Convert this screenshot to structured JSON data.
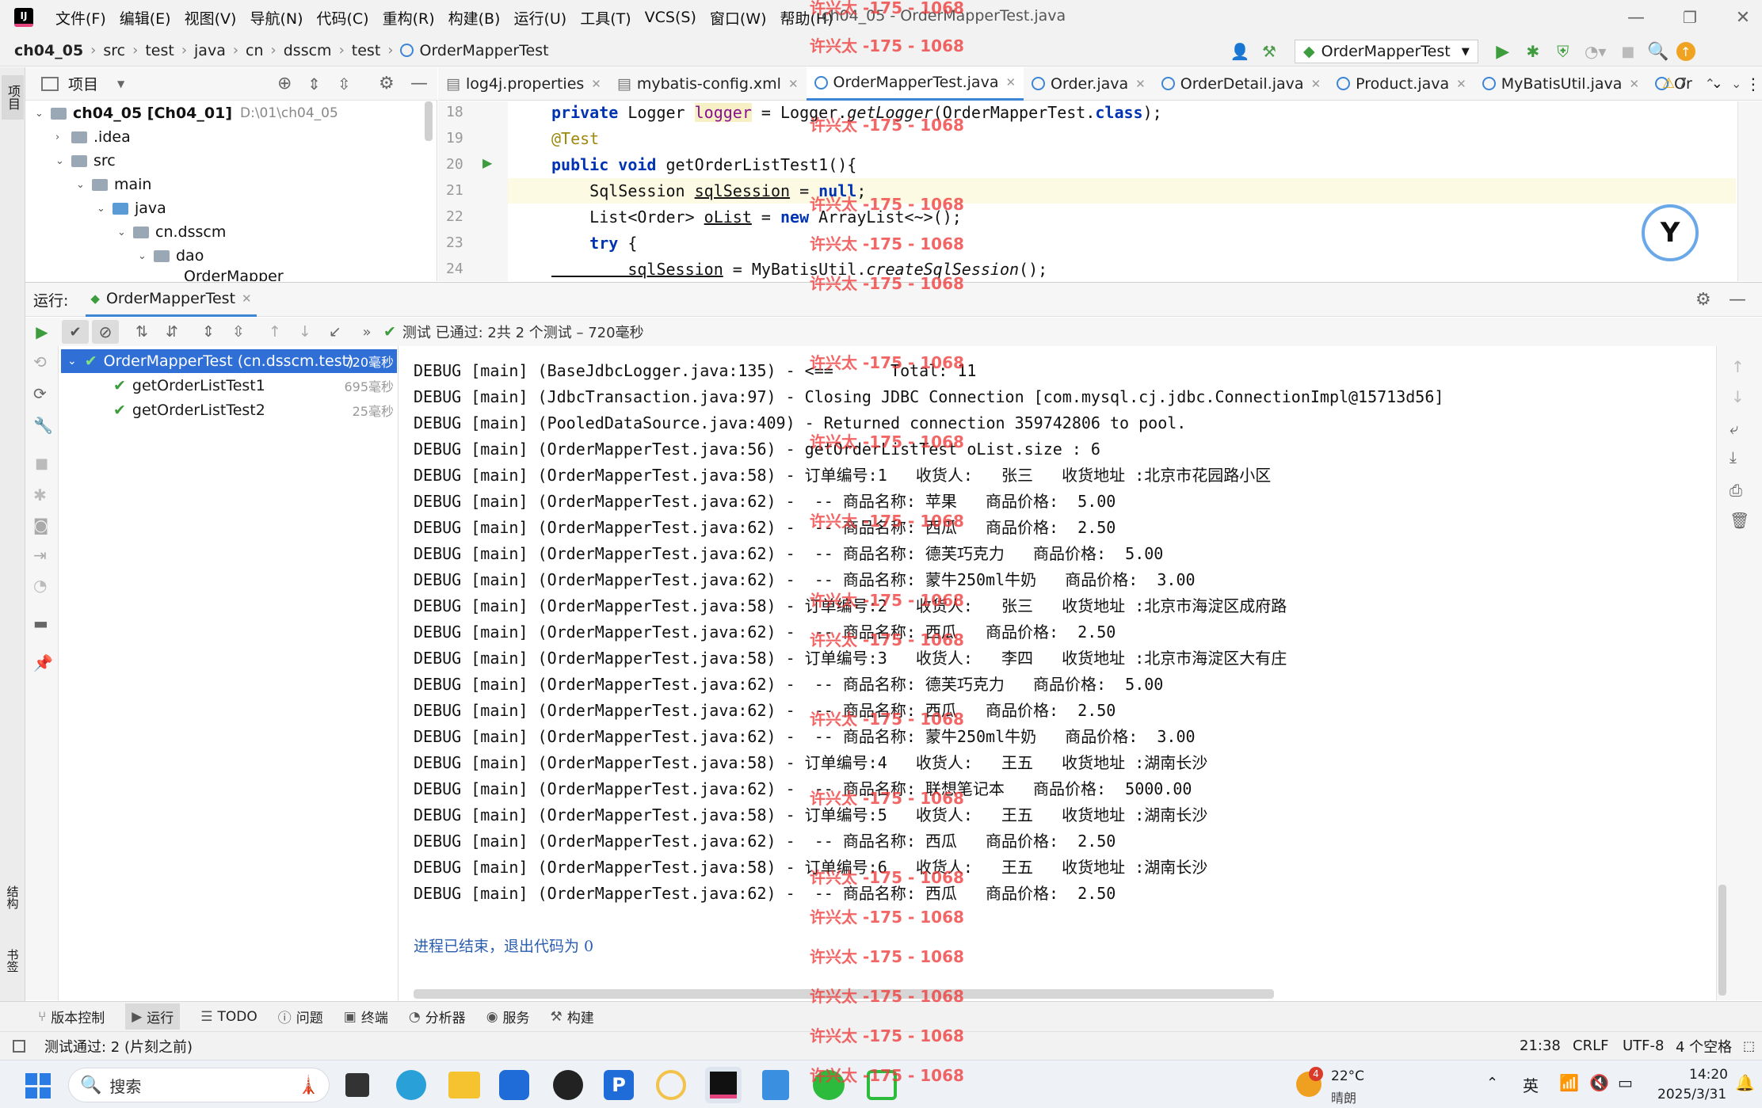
{
  "titlebar": {
    "menus": [
      "文件(F)",
      "编辑(E)",
      "视图(V)",
      "导航(N)",
      "代码(C)",
      "重构(R)",
      "构建(B)",
      "运行(U)",
      "工具(T)",
      "VCS(S)",
      "窗口(W)",
      "帮助(H)"
    ],
    "title": "ch04_05 - OrderMapperTest.java"
  },
  "nav": {
    "crumbs": [
      "ch04_05",
      "src",
      "test",
      "java",
      "cn",
      "dsscm",
      "test",
      "OrderMapperTest"
    ],
    "run_config": "OrderMapperTest"
  },
  "project": {
    "header": "项目",
    "items": [
      {
        "label": "ch04_05 [Ch04_01]",
        "hint": "D:\\01\\ch04_05"
      },
      {
        "label": ".idea"
      },
      {
        "label": "src"
      },
      {
        "label": "main"
      },
      {
        "label": "java"
      },
      {
        "label": "cn.dsscm"
      },
      {
        "label": "dao"
      },
      {
        "label": "OrderMapper"
      }
    ]
  },
  "editor": {
    "tabs": [
      "log4j.properties",
      "mybatis-config.xml",
      "OrderMapperTest.java",
      "Order.java",
      "OrderDetail.java",
      "Product.java",
      "MyBatisUtil.java",
      "Or"
    ],
    "warnings": "7",
    "line_numbers": [
      "18",
      "19",
      "20",
      "21",
      "22",
      "23",
      "24"
    ],
    "lines": [
      [
        {
          "t": "private ",
          "c": "kw"
        },
        {
          "t": "Logger "
        },
        {
          "t": "logger",
          "c": "fld"
        },
        {
          "t": " = Logger."
        },
        {
          "t": "getLogger",
          "c": "ital"
        },
        {
          "t": "(OrderMapperTest."
        },
        {
          "t": "class",
          "c": "kw"
        },
        {
          "t": ");"
        }
      ],
      [
        {
          "t": "@Test",
          "c": "ann"
        }
      ],
      [
        {
          "t": "public void ",
          "c": "kw"
        },
        {
          "t": "getOrderListTest1(){"
        }
      ],
      [
        {
          "t": "    SqlSession "
        },
        {
          "t": "sqlSession",
          "c": "u"
        },
        {
          "t": " = "
        },
        {
          "t": "null",
          "c": "kw"
        },
        {
          "t": ";"
        }
      ],
      [
        {
          "t": "    List<Order> "
        },
        {
          "t": "oList",
          "c": "u"
        },
        {
          "t": " = "
        },
        {
          "t": "new ",
          "c": "kw"
        },
        {
          "t": "ArrayList<~>();"
        }
      ],
      [
        {
          "t": "    "
        },
        {
          "t": "try ",
          "c": "kw"
        },
        {
          "t": "{"
        }
      ],
      [
        {
          "t": "        sqlSession",
          "c": "u"
        },
        {
          "t": " = MyBatisUtil."
        },
        {
          "t": "createSqlSession",
          "c": "ital"
        },
        {
          "t": "();"
        }
      ]
    ]
  },
  "run": {
    "label": "运行:",
    "tab": "OrderMapperTest",
    "status": "测试 已通过: 2共 2 个测试 – 720毫秒",
    "tests": [
      {
        "name": "OrderMapperTest (cn.dsscm.test)",
        "time": "720毫秒"
      },
      {
        "name": "getOrderListTest1",
        "time": "695毫秒"
      },
      {
        "name": "getOrderListTest2",
        "time": "25毫秒"
      }
    ]
  },
  "console": {
    "lines": [
      "DEBUG [main] (BaseJdbcLogger.java:135) - <==      Total: 11",
      "DEBUG [main] (JdbcTransaction.java:97) - Closing JDBC Connection [com.mysql.cj.jdbc.ConnectionImpl@15713d56]",
      "DEBUG [main] (PooledDataSource.java:409) - Returned connection 359742806 to pool.",
      "DEBUG [main] (OrderMapperTest.java:56) - getOrderListTest oList.size : 6",
      "DEBUG [main] (OrderMapperTest.java:58) - 订单编号:1   收货人:   张三   收货地址 :北京市花园路小区",
      "DEBUG [main] (OrderMapperTest.java:62) -  -- 商品名称: 苹果   商品价格:  5.00",
      "DEBUG [main] (OrderMapperTest.java:62) -  -- 商品名称: 西瓜   商品价格:  2.50",
      "DEBUG [main] (OrderMapperTest.java:62) -  -- 商品名称: 德芙巧克力   商品价格:  5.00",
      "DEBUG [main] (OrderMapperTest.java:62) -  -- 商品名称: 蒙牛250ml牛奶   商品价格:  3.00",
      "DEBUG [main] (OrderMapperTest.java:58) - 订单编号:2   收货人:   张三   收货地址 :北京市海淀区成府路",
      "DEBUG [main] (OrderMapperTest.java:62) -  -- 商品名称: 西瓜   商品价格:  2.50",
      "DEBUG [main] (OrderMapperTest.java:58) - 订单编号:3   收货人:   李四   收货地址 :北京市海淀区大有庄",
      "DEBUG [main] (OrderMapperTest.java:62) -  -- 商品名称: 德芙巧克力   商品价格:  5.00",
      "DEBUG [main] (OrderMapperTest.java:62) -  -- 商品名称: 西瓜   商品价格:  2.50",
      "DEBUG [main] (OrderMapperTest.java:62) -  -- 商品名称: 蒙牛250ml牛奶   商品价格:  3.00",
      "DEBUG [main] (OrderMapperTest.java:58) - 订单编号:4   收货人:   王五   收货地址 :湖南长沙",
      "DEBUG [main] (OrderMapperTest.java:62) -  -- 商品名称: 联想笔记本   商品价格:  5000.00",
      "DEBUG [main] (OrderMapperTest.java:58) - 订单编号:5   收货人:   王五   收货地址 :湖南长沙",
      "DEBUG [main] (OrderMapperTest.java:62) -  -- 商品名称: 西瓜   商品价格:  2.50",
      "DEBUG [main] (OrderMapperTest.java:58) - 订单编号:6   收货人:   王五   收货地址 :湖南长沙",
      "DEBUG [main] (OrderMapperTest.java:62) -  -- 商品名称: 西瓜   商品价格:  2.50"
    ],
    "exit": "进程已结束，退出代码为 0"
  },
  "watermark": "许兴太 -175 - 1068",
  "toolwindows": [
    "版本控制",
    "运行",
    "TODO",
    "问题",
    "终端",
    "分析器",
    "服务",
    "构建"
  ],
  "side_labels": [
    "项目",
    "结构",
    "书签"
  ],
  "status": {
    "left": "测试通过: 2 (片刻之前)",
    "pos": "21:38",
    "eol": "CRLF",
    "enc": "UTF-8",
    "indent": "4 个空格"
  },
  "taskbar": {
    "search": "搜索",
    "temp": "22°C",
    "weather": "晴朗",
    "badge": "4",
    "ime": "英",
    "time": "14:20",
    "date": "2025/3/31"
  },
  "colors": {
    "accent": "#3d86d6",
    "pass": "#3d9c3d",
    "watermark": "#f03c3c",
    "keyword": "#0033b3"
  }
}
